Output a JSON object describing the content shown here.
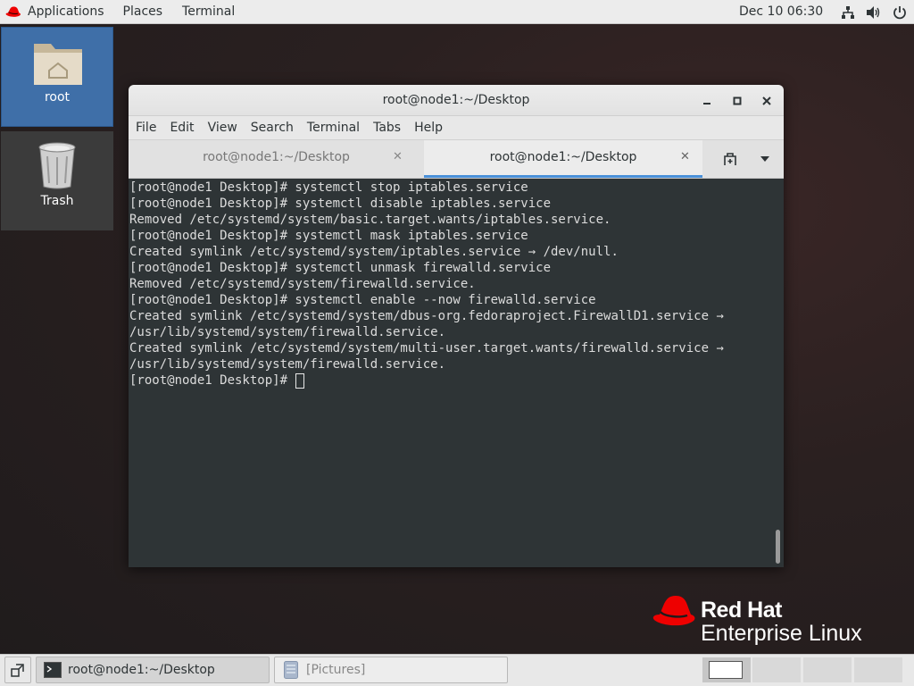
{
  "topbar": {
    "applications_label": "Applications",
    "places_label": "Places",
    "terminal_label": "Terminal",
    "clock": "Dec 10  06:30",
    "icons": [
      "network-icon",
      "volume-icon",
      "power-icon"
    ]
  },
  "desktop": {
    "icons": [
      {
        "label": "root",
        "icon": "home-folder-icon",
        "selected": true
      },
      {
        "label": "Trash",
        "icon": "trash-icon",
        "selected": false
      }
    ]
  },
  "terminal_window": {
    "title": "root@node1:~/Desktop",
    "menu": [
      "File",
      "Edit",
      "View",
      "Search",
      "Terminal",
      "Tabs",
      "Help"
    ],
    "tabs": [
      {
        "label": "root@node1:~/Desktop",
        "active": false
      },
      {
        "label": "root@node1:~/Desktop",
        "active": true
      }
    ],
    "lines": [
      "[root@node1 Desktop]# systemctl stop iptables.service",
      "[root@node1 Desktop]# systemctl disable iptables.service",
      "Removed /etc/systemd/system/basic.target.wants/iptables.service.",
      "[root@node1 Desktop]# systemctl mask iptables.service",
      "Created symlink /etc/systemd/system/iptables.service → /dev/null.",
      "[root@node1 Desktop]# systemctl unmask firewalld.service",
      "Removed /etc/systemd/system/firewalld.service.",
      "[root@node1 Desktop]# systemctl enable --now firewalld.service",
      "Created symlink /etc/systemd/system/dbus-org.fedoraproject.FirewallD1.service →",
      "/usr/lib/systemd/system/firewalld.service.",
      "Created symlink /etc/systemd/system/multi-user.target.wants/firewalld.service →",
      "/usr/lib/systemd/system/firewalld.service."
    ],
    "prompt": "[root@node1 Desktop]# "
  },
  "branding": {
    "line1": "Red Hat",
    "line2": "Enterprise Linux",
    "color": "#ee0000"
  },
  "taskbar": {
    "items": [
      {
        "label": "root@node1:~/Desktop",
        "icon": "terminal-icon",
        "active": true
      },
      {
        "label": "[Pictures]",
        "icon": "file-manager-icon",
        "active": false
      }
    ],
    "workspace_count": 4
  }
}
